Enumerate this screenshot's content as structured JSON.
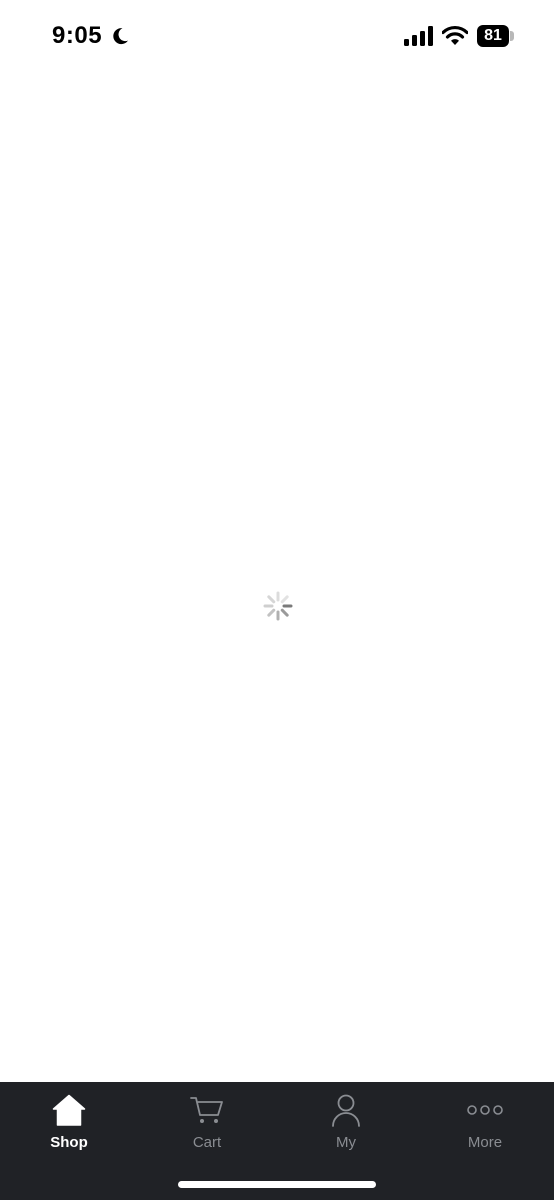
{
  "status_bar": {
    "time": "9:05",
    "battery": "81",
    "icons": [
      "moon-icon",
      "signal-icon",
      "wifi-icon",
      "battery-icon"
    ]
  },
  "content": {
    "state": "loading",
    "icon": "spinner-icon"
  },
  "tab_bar": {
    "background": "#202226",
    "active_color": "#ffffff",
    "inactive_color": "#8a8d92",
    "tabs": [
      {
        "label": "Shop",
        "icon": "home-icon",
        "active": true
      },
      {
        "label": "Cart",
        "icon": "cart-icon",
        "active": false
      },
      {
        "label": "My",
        "icon": "person-icon",
        "active": false
      },
      {
        "label": "More",
        "icon": "more-icon",
        "active": false
      }
    ]
  }
}
